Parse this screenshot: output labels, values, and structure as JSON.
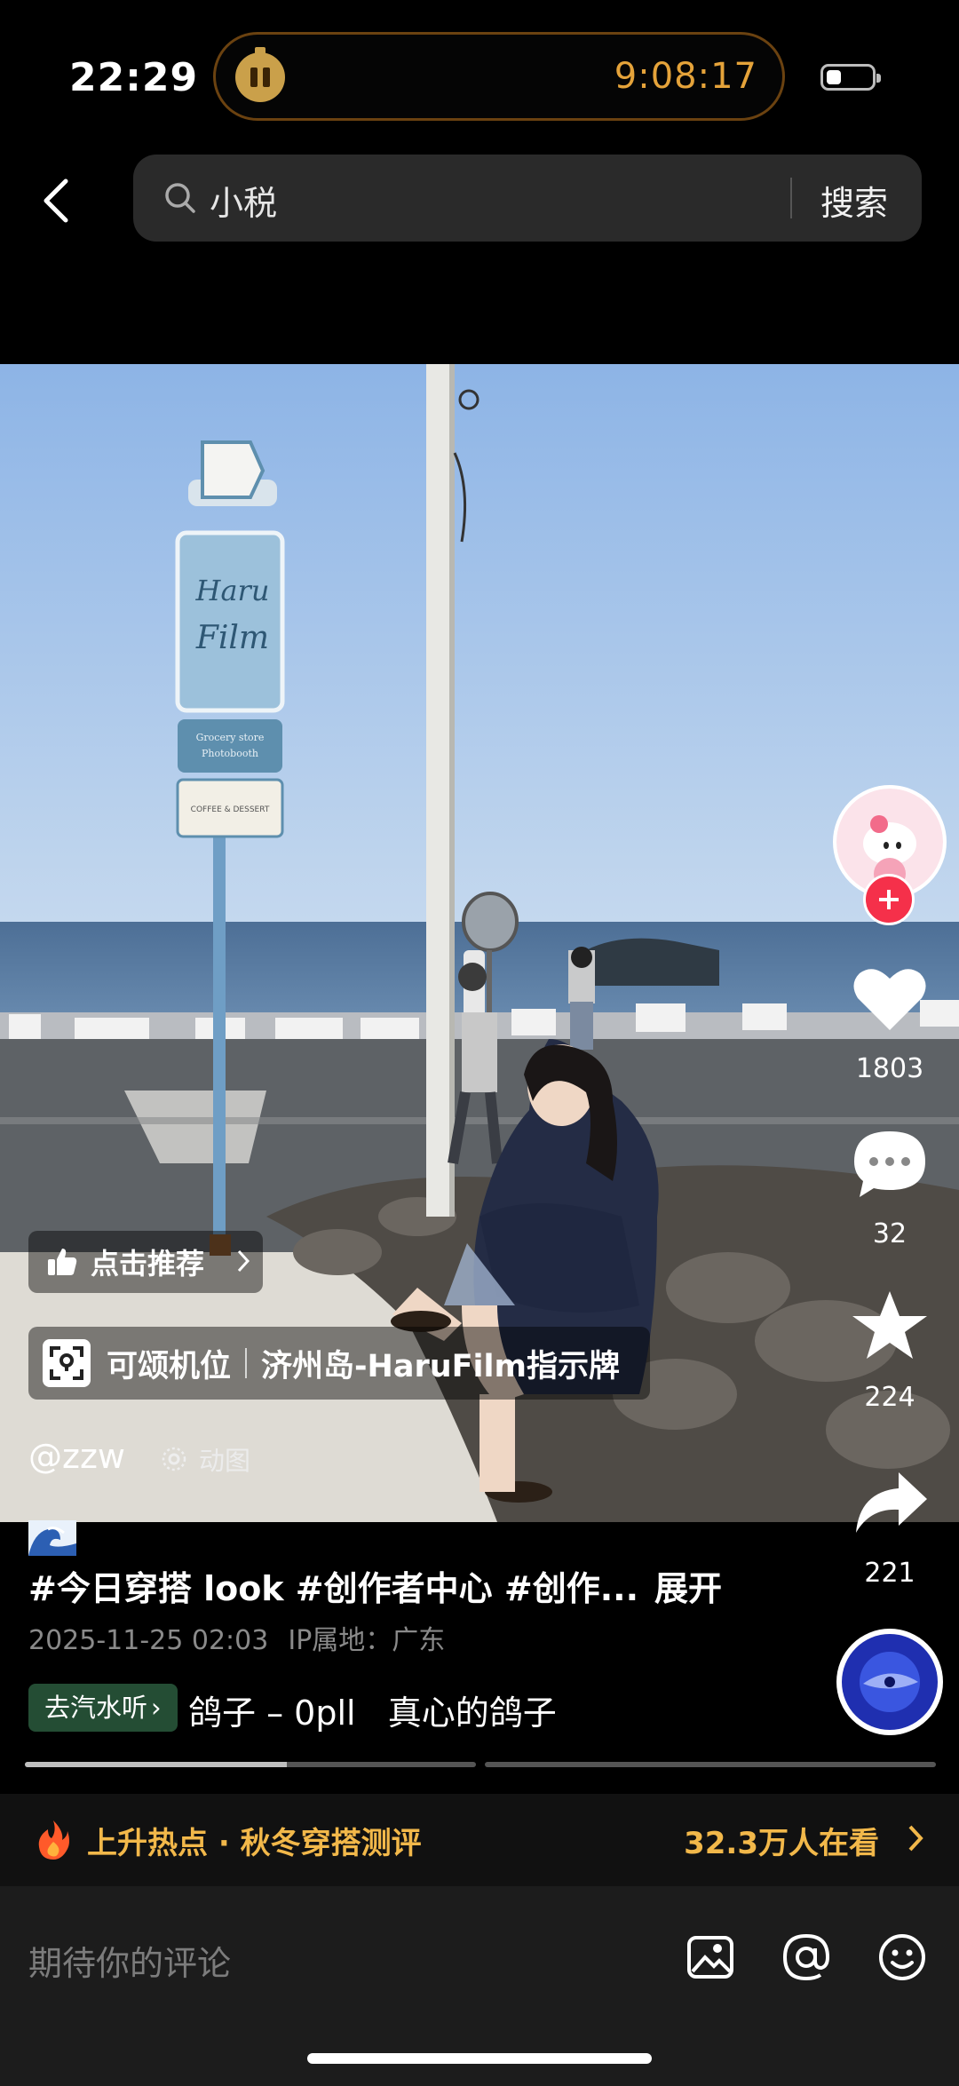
{
  "status_bar": {
    "time": "22:29",
    "timer": "9:08:17"
  },
  "search": {
    "query": "小税",
    "button_label": "搜索"
  },
  "overlay": {
    "recommend_label": "点击推荐",
    "location_type": "可颂机位",
    "location_name": "济州岛-HaruFilm指示牌",
    "author": "@zzw",
    "media_tag": "动图",
    "sign_text": [
      "Haru",
      "Film",
      "Grocery store",
      "Photobooth",
      "COFFEE & DESSERT"
    ]
  },
  "rail": {
    "likes": "1803",
    "comments": "32",
    "favorites": "224",
    "shares": "221"
  },
  "post": {
    "caption": "#今日穿搭 look #创作者中心 #创作...",
    "expand_label": "展开",
    "date": "2025-11-25 02:03",
    "ip_location": "IP属地：广东",
    "music_pill": "去汽水听",
    "music_text": "鸽子 – 0pll   真心的鸽子",
    "progress": 0.58
  },
  "hot_topic": {
    "label": "上升热点 · 秋冬穿搭测评",
    "viewers": "32.3万人在看"
  },
  "comment_bar": {
    "placeholder": "期待你的评论"
  },
  "icons": [
    "back-icon",
    "search-icon",
    "thumbs-up-icon",
    "scan-location-icon",
    "live-photo-icon",
    "heart-icon",
    "comment-icon",
    "star-icon",
    "share-icon",
    "flame-icon",
    "image-icon",
    "at-icon",
    "emoji-icon"
  ],
  "colors": {
    "accent_red": "#f5304a",
    "hot_gold": "#f2b84a",
    "timer_orange": "#e5a33a",
    "music_green": "#244d34"
  }
}
